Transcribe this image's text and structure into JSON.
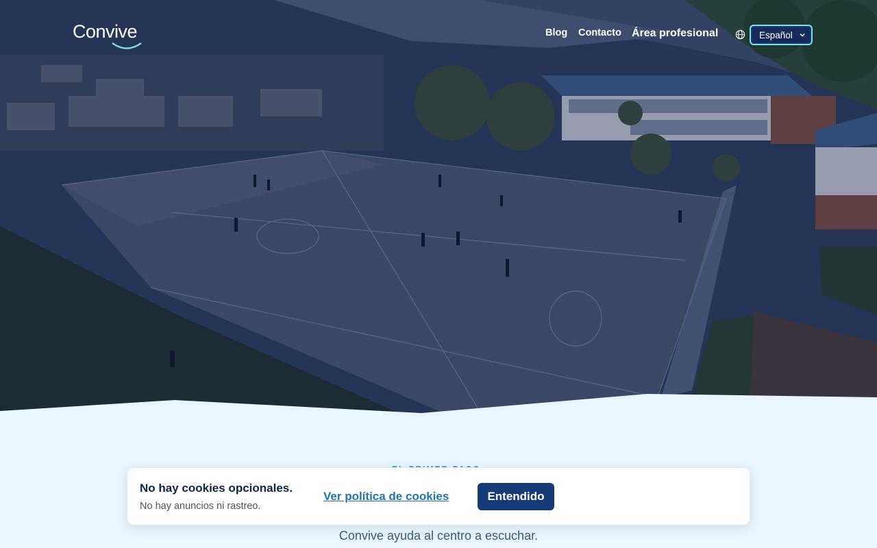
{
  "header": {
    "logo_text": "Convive",
    "nav": {
      "blog": "Blog",
      "contacto": "Contacto",
      "area_profesional": "Área profesional"
    },
    "language": {
      "selected": "Español",
      "icon": "globe-icon"
    }
  },
  "hero": {
    "image": "aerial-school-playground-photo"
  },
  "section": {
    "eyebrow": "EL PRIMER PASO",
    "tagline": "Convive ayuda al centro a escuchar."
  },
  "cookie_banner": {
    "title": "No hay cookies opcionales.",
    "subtitle": "No hay anuncios ni rastreo.",
    "policy_link": "Ver política de cookies",
    "accept_button": "Entendido"
  },
  "colors": {
    "brand_navy": "#173a78",
    "link_blue": "#2373ad",
    "page_bg": "#eaf6fd",
    "lang_border": "#7fe0ea"
  }
}
